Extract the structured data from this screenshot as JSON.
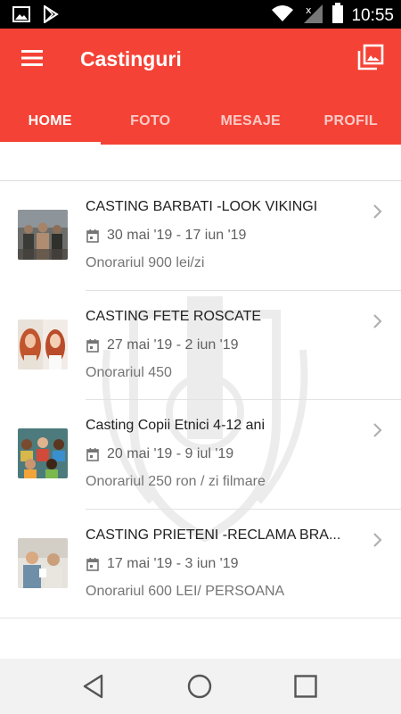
{
  "status_bar": {
    "time": "10:55",
    "icons": [
      "image-icon",
      "play-store-icon",
      "wifi-icon",
      "signal-icon",
      "battery-icon"
    ]
  },
  "app_bar": {
    "title": "Castinguri",
    "menu_icon": "menu-icon",
    "gallery_icon": "photo-library-icon",
    "color": "#f44336"
  },
  "tabs": [
    {
      "label": "HOME",
      "active": true
    },
    {
      "label": "FOTO",
      "active": false
    },
    {
      "label": "MESAJE",
      "active": false
    },
    {
      "label": "PROFIL",
      "active": false
    }
  ],
  "castings": [
    {
      "title": "CASTING BARBATI -LOOK VIKINGI",
      "date": "30 mai '19 - 17 iun '19",
      "fee": "Onorariul 900 lei/zi",
      "thumb": "vikings-photo"
    },
    {
      "title": "CASTING FETE ROSCATE",
      "date": "27 mai '19 - 2 iun '19",
      "fee": "Onorariul 450",
      "thumb": "redheads-photo"
    },
    {
      "title": "Casting Copii Etnici 4-12 ani",
      "date": "20 mai '19 - 9 iul '19",
      "fee": "Onorariul 250 ron / zi filmare",
      "thumb": "children-photo"
    },
    {
      "title": "CASTING PRIETENI -RECLAMA BRA...",
      "date": "17 mai '19 - 3 iun '19",
      "fee": "Onorariul 600 LEI/ PERSOANA",
      "thumb": "friends-photo"
    }
  ],
  "nav_bar": {
    "icons": [
      "back-icon",
      "home-icon",
      "recents-icon"
    ]
  }
}
